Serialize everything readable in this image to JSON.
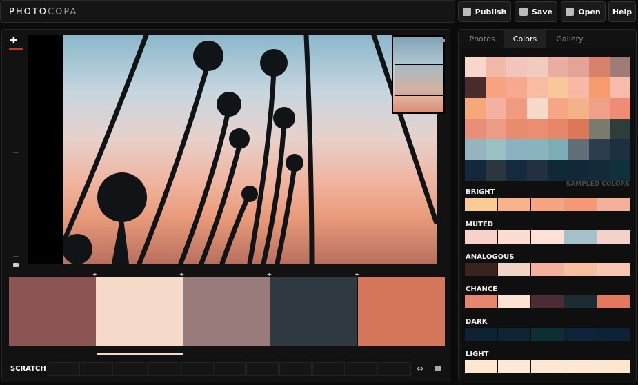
{
  "app": {
    "logo_main": "PHOTO",
    "logo_sub": "COPA"
  },
  "toolbar": {
    "publish": "Publish",
    "save": "Save",
    "open": "Open",
    "help": "Help"
  },
  "palette": [
    {
      "color": "#8b5455"
    },
    {
      "color": "#f5d9c9"
    },
    {
      "color": "#9a7b7b"
    },
    {
      "color": "#2e3942"
    },
    {
      "color": "#d4765a"
    }
  ],
  "scratch": {
    "label": "SCRATCH"
  },
  "tabs": [
    {
      "label": "Photos"
    },
    {
      "label": "Colors"
    },
    {
      "label": "Gallery"
    }
  ],
  "sampled_label": "SAMPLED COLORS",
  "sampled_colors": [
    [
      "#f8d6cc",
      "#f2b8a8",
      "#f3c4bc",
      "#f2cbbf",
      "#e9aea1",
      "#e3a497",
      "#d8826b",
      "#a07c79"
    ],
    [
      "#4a2c2d",
      "#f7a280",
      "#f8a88e",
      "#f9bba2",
      "#fac898",
      "#f9b8a6",
      "#f79a6c",
      "#f6bca9"
    ],
    [
      "#f7a878",
      "#f4b0a0",
      "#f09a80",
      "#f6dacc",
      "#f5a686",
      "#f3b288",
      "#efa088",
      "#f08c76"
    ],
    [
      "#e98f78",
      "#ec9c86",
      "#e98b6f",
      "#ea8d73",
      "#e68667",
      "#dc7859",
      "#7b7a6e",
      "#2e3c3b"
    ],
    [
      "#96b4c0",
      "#9ac0c4",
      "#8bb2c0",
      "#89b4be",
      "#7cacb4",
      "#646e7a",
      "#2e3d4c",
      "#1d3040"
    ],
    [
      "#14283b",
      "#2b363f",
      "#162a3e",
      "#223040",
      "#0f2a36",
      "#102838",
      "#142a38",
      "#10303c"
    ]
  ],
  "schemes": [
    {
      "label": "BRIGHT",
      "colors": [
        "#fbcb96",
        "#f9b38a",
        "#f7a480",
        "#f69874",
        "#f4b09a"
      ]
    },
    {
      "label": "MUTED",
      "colors": [
        "#f8d2ca",
        "#fbddd2",
        "#fce2d6",
        "#a5c2cc",
        "#f3d2ca"
      ]
    },
    {
      "label": "ANALOGOUS",
      "colors": [
        "#3a2221",
        "#f0d5c4",
        "#f3b09c",
        "#f8bf9e",
        "#fac4b2"
      ]
    },
    {
      "label": "CHANCE",
      "colors": [
        "#e6866c",
        "#fbe2d2",
        "#4a2c34",
        "#1c2c33",
        "#e3775f"
      ]
    },
    {
      "label": "DARK",
      "colors": [
        "#0f2233",
        "#0e2435",
        "#0c2f34",
        "#0f2338",
        "#0e2236"
      ]
    },
    {
      "label": "LIGHT",
      "colors": [
        "#fde6d2",
        "#fce9d8",
        "#fde6d4",
        "#fde6d2",
        "#fde6d0"
      ]
    }
  ]
}
